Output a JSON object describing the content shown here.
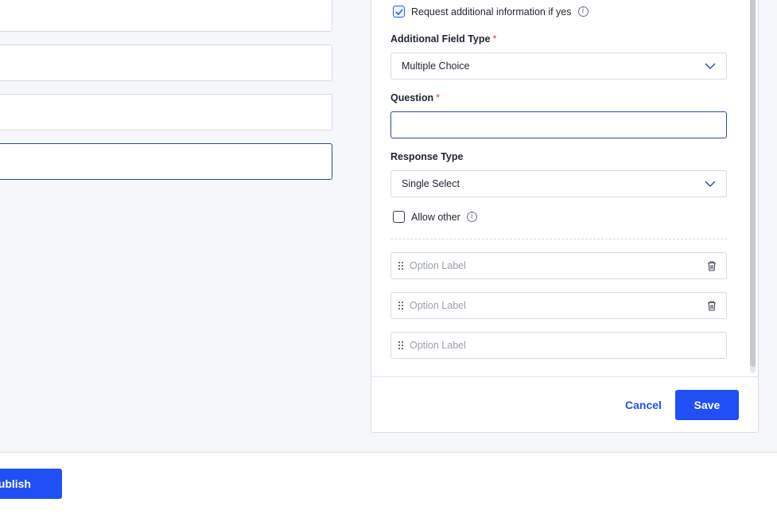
{
  "left_form": {
    "fields": [
      {
        "value": ""
      },
      {
        "value": ""
      },
      {
        "value": ""
      },
      {
        "value": ""
      }
    ]
  },
  "bottom_bar": {
    "publish_label": "ublish"
  },
  "panel": {
    "request_info": {
      "label": "Request additional information if yes",
      "checked": true
    },
    "additional_field_type": {
      "label": "Additional Field Type",
      "required_mark": "*",
      "selected": "Multiple Choice"
    },
    "question": {
      "label": "Question",
      "required_mark": "*",
      "value": ""
    },
    "response_type": {
      "label": "Response Type",
      "selected": "Single Select"
    },
    "allow_other": {
      "label": "Allow other",
      "checked": false
    },
    "options": [
      {
        "placeholder": "Option Label",
        "deletable": true
      },
      {
        "placeholder": "Option Label",
        "deletable": true
      },
      {
        "placeholder": "Option Label",
        "deletable": false
      }
    ],
    "footer": {
      "cancel_label": "Cancel",
      "save_label": "Save"
    }
  },
  "colors": {
    "primary": "#1f4ff5",
    "required": "#e0413b",
    "focus_border": "#2b4aa8"
  },
  "icons": {
    "checkbox_checked": "check-icon",
    "info": "info-icon",
    "dropdown": "chevron-down-icon",
    "drag": "drag-handle-icon",
    "delete": "trash-icon"
  }
}
